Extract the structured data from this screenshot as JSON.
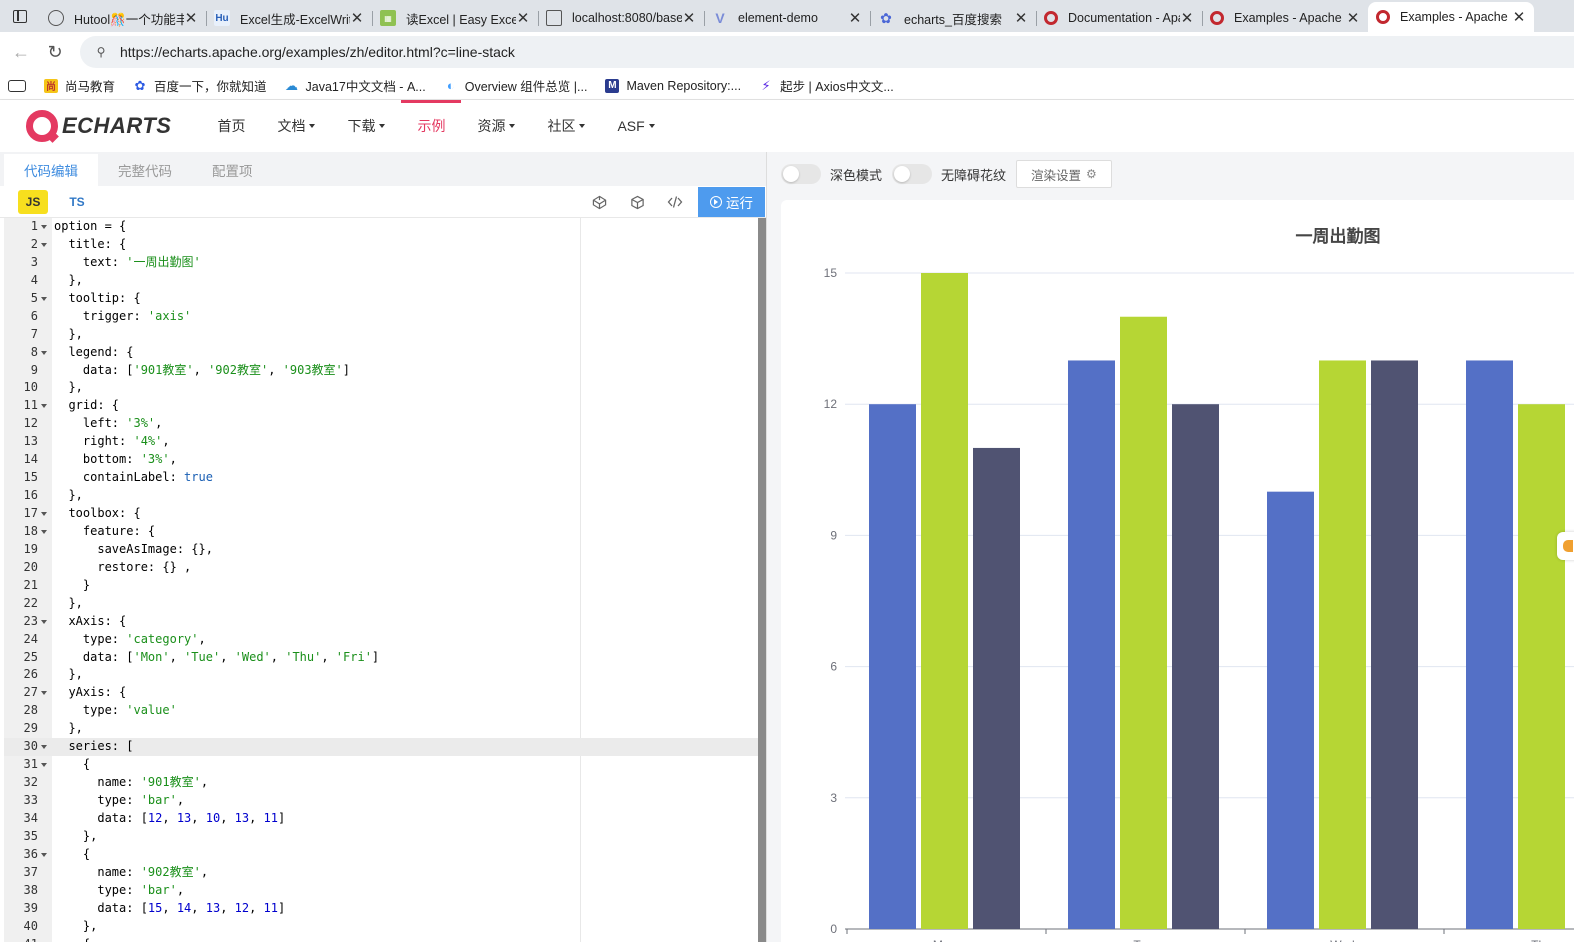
{
  "browser": {
    "tabs": [
      {
        "title": "Hutool🎊一个功能丰富",
        "icon": "globe-icon"
      },
      {
        "title": "Excel生成-ExcelWriter",
        "icon": "hu-icon"
      },
      {
        "title": "读Excel | Easy Excel",
        "icon": "easyexcel-icon"
      },
      {
        "title": "localhost:8080/base",
        "icon": "image-icon"
      },
      {
        "title": "element-demo",
        "icon": "vue-icon"
      },
      {
        "title": "echarts_百度搜索",
        "icon": "baidu-paw-icon"
      },
      {
        "title": "Documentation - Apache",
        "icon": "echarts-icon"
      },
      {
        "title": "Examples - Apache ECharts",
        "icon": "echarts-icon"
      },
      {
        "title": "Examples - Apache ECharts",
        "icon": "echarts-icon",
        "active": true
      }
    ],
    "url": "https://echarts.apache.org/examples/zh/editor.html?c=line-stack",
    "bookmarks": [
      {
        "label": "尚马教育",
        "icon": "shangma-icon"
      },
      {
        "label": "百度一下，你就知道",
        "icon": "baidu-paw-icon"
      },
      {
        "label": "Java17中文文档 - A...",
        "icon": "cloud-icon"
      },
      {
        "label": "Overview 组件总览 |...",
        "icon": "component-icon"
      },
      {
        "label": "Maven Repository:...",
        "icon": "maven-icon"
      },
      {
        "label": "起步 | Axios中文文...",
        "icon": "axios-icon"
      }
    ]
  },
  "site": {
    "logo": "ECHARTS",
    "nav": [
      {
        "label": "首页",
        "caret": false
      },
      {
        "label": "文档",
        "caret": true
      },
      {
        "label": "下载",
        "caret": true
      },
      {
        "label": "示例",
        "caret": false,
        "active": true
      },
      {
        "label": "资源",
        "caret": true
      },
      {
        "label": "社区",
        "caret": true
      },
      {
        "label": "ASF",
        "caret": true
      }
    ]
  },
  "editor": {
    "tabs": [
      "代码编辑",
      "完整代码",
      "配置项"
    ],
    "lang_js": "JS",
    "lang_ts": "TS",
    "run_label": "运行",
    "lines": [
      {
        "n": 1,
        "fold": true,
        "html": "option = {"
      },
      {
        "n": 2,
        "fold": true,
        "html": "  title: {"
      },
      {
        "n": 3,
        "fold": false,
        "html": "    text: <span class='s'>'一周出勤图'</span>"
      },
      {
        "n": 4,
        "fold": false,
        "html": "  },"
      },
      {
        "n": 5,
        "fold": true,
        "html": "  tooltip: {"
      },
      {
        "n": 6,
        "fold": false,
        "html": "    trigger: <span class='s'>'axis'</span>"
      },
      {
        "n": 7,
        "fold": false,
        "html": "  },"
      },
      {
        "n": 8,
        "fold": true,
        "html": "  legend: {"
      },
      {
        "n": 9,
        "fold": false,
        "html": "    data: [<span class='s'>'901教室'</span>, <span class='s'>'902教室'</span>, <span class='s'>'903教室'</span>]"
      },
      {
        "n": 10,
        "fold": false,
        "html": "  },"
      },
      {
        "n": 11,
        "fold": true,
        "html": "  grid: {"
      },
      {
        "n": 12,
        "fold": false,
        "html": "    left: <span class='s'>'3%'</span>,"
      },
      {
        "n": 13,
        "fold": false,
        "html": "    right: <span class='s'>'4%'</span>,"
      },
      {
        "n": 14,
        "fold": false,
        "html": "    bottom: <span class='s'>'3%'</span>,"
      },
      {
        "n": 15,
        "fold": false,
        "html": "    containLabel: <span class='k'>true</span>"
      },
      {
        "n": 16,
        "fold": false,
        "html": "  },"
      },
      {
        "n": 17,
        "fold": true,
        "html": "  toolbox: {"
      },
      {
        "n": 18,
        "fold": true,
        "html": "    feature: {"
      },
      {
        "n": 19,
        "fold": false,
        "html": "      saveAsImage: {},"
      },
      {
        "n": 20,
        "fold": false,
        "html": "      restore: {} ,"
      },
      {
        "n": 21,
        "fold": false,
        "html": "    }"
      },
      {
        "n": 22,
        "fold": false,
        "html": "  },"
      },
      {
        "n": 23,
        "fold": true,
        "html": "  xAxis: {"
      },
      {
        "n": 24,
        "fold": false,
        "html": "    type: <span class='s'>'category'</span>,"
      },
      {
        "n": 25,
        "fold": false,
        "html": "    data: [<span class='s'>'Mon'</span>, <span class='s'>'Tue'</span>, <span class='s'>'Wed'</span>, <span class='s'>'Thu'</span>, <span class='s'>'Fri'</span>]"
      },
      {
        "n": 26,
        "fold": false,
        "html": "  },"
      },
      {
        "n": 27,
        "fold": true,
        "html": "  yAxis: {"
      },
      {
        "n": 28,
        "fold": false,
        "html": "    type: <span class='s'>'value'</span>"
      },
      {
        "n": 29,
        "fold": false,
        "html": "  },"
      },
      {
        "n": 30,
        "fold": true,
        "hl": true,
        "html": "  series: ["
      },
      {
        "n": 31,
        "fold": true,
        "html": "    {"
      },
      {
        "n": 32,
        "fold": false,
        "html": "      name: <span class='s'>'901教室'</span>,"
      },
      {
        "n": 33,
        "fold": false,
        "html": "      type: <span class='s'>'bar'</span>,"
      },
      {
        "n": 34,
        "fold": false,
        "html": "      data: [<span class='n'>12</span>, <span class='n'>13</span>, <span class='n'>10</span>, <span class='n'>13</span>, <span class='n'>11</span>]"
      },
      {
        "n": 35,
        "fold": false,
        "html": "    },"
      },
      {
        "n": 36,
        "fold": true,
        "html": "    {"
      },
      {
        "n": 37,
        "fold": false,
        "html": "      name: <span class='s'>'902教室'</span>,"
      },
      {
        "n": 38,
        "fold": false,
        "html": "      type: <span class='s'>'bar'</span>,"
      },
      {
        "n": 39,
        "fold": false,
        "html": "      data: [<span class='n'>15</span>, <span class='n'>14</span>, <span class='n'>13</span>, <span class='n'>12</span>, <span class='n'>11</span>]"
      },
      {
        "n": 40,
        "fold": false,
        "html": "    },"
      },
      {
        "n": 41,
        "fold": true,
        "html": "    {"
      }
    ]
  },
  "preview": {
    "dark_mode_label": "深色模式",
    "aria_label": "无障碍花纹",
    "render_settings_label": "渲染设置"
  },
  "chart_data": {
    "type": "bar",
    "title": "一周出勤图",
    "categories": [
      "Mon",
      "Tue",
      "Wed",
      "Thu"
    ],
    "series": [
      {
        "values": [
          12,
          13,
          10,
          13
        ],
        "color": "#5470c6"
      },
      {
        "values": [
          15,
          14,
          13,
          12
        ],
        "color": "#b6d634"
      },
      {
        "values": [
          11,
          12,
          13
        ],
        "color": "#505372"
      }
    ],
    "ylim": [
      0,
      15
    ],
    "yticks": [
      0,
      3,
      6,
      9,
      12,
      15
    ],
    "grid": true
  }
}
